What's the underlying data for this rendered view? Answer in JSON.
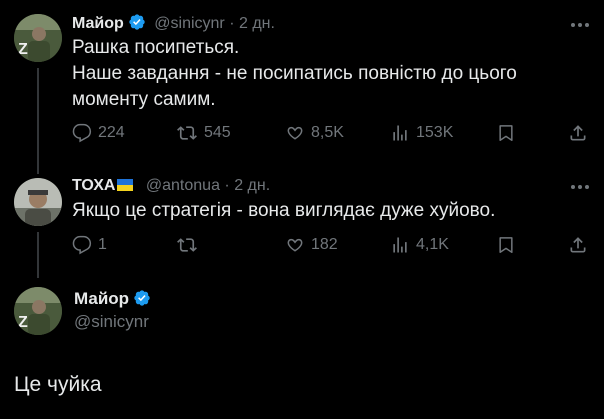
{
  "tweet1": {
    "name": "Майор",
    "handle": "@sinicynr",
    "time": "· 2 дн.",
    "lines": [
      "Рашка посипеться.",
      "Наше завдання - не посипатись повністю до цього",
      "моменту самим."
    ],
    "replies": "224",
    "retweets": "545",
    "likes": "8,5K",
    "views": "153K"
  },
  "tweet2": {
    "name": "ТОХА",
    "handle": "@antonua",
    "time": "· 2 дн.",
    "text": "Якщо це стратегія - вона виглядає дуже хуйово.",
    "replies": "1",
    "retweets": "",
    "likes": "182",
    "views": "4,1K"
  },
  "tweet3": {
    "name": "Майор",
    "handle": "@sinicynr",
    "text": "Це чуйка"
  },
  "colors": {
    "background": "#000000",
    "text": "#e7e9ea",
    "muted": "#71767b",
    "verified": "#1d9bf0"
  }
}
